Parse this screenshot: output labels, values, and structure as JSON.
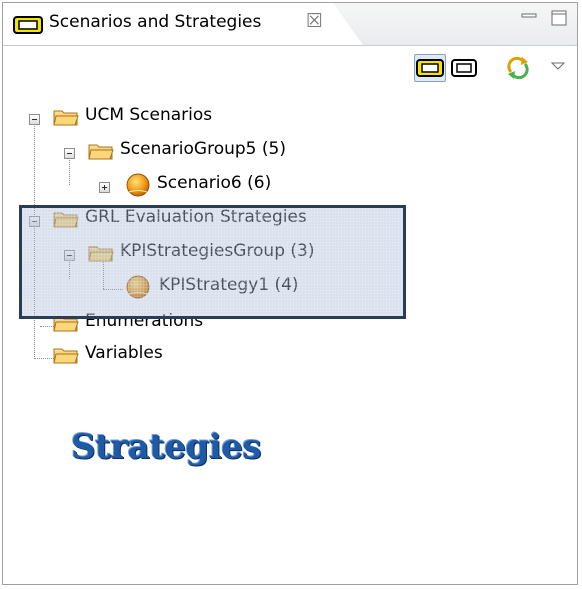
{
  "view": {
    "title": "Scenarios and Strategies",
    "close_glyph": "☒"
  },
  "toolbar": {
    "buttons": [
      {
        "name": "scenario-view-icon",
        "state": "active"
      },
      {
        "name": "strategy-view-icon",
        "state": "inactive"
      },
      {
        "name": "sync-icon"
      },
      {
        "name": "view-menu-icon"
      }
    ]
  },
  "tree": {
    "items": [
      {
        "label": "UCM Scenarios",
        "icon": "folder-icon",
        "expanded": true
      },
      {
        "label": "ScenarioGroup5 (5)",
        "icon": "folder-icon",
        "expanded": true
      },
      {
        "label": "Scenario6 (6)",
        "icon": "ucm-scenario-icon",
        "expanded": false
      },
      {
        "label": "GRL Evaluation Strategies",
        "icon": "folder-icon",
        "expanded": true
      },
      {
        "label": "KPIStrategiesGroup (3)",
        "icon": "folder-icon",
        "expanded": true
      },
      {
        "label": "KPIStrategy1 (4)",
        "icon": "grl-strategy-icon"
      },
      {
        "label": "Enumerations",
        "icon": "folder-icon"
      },
      {
        "label": "Variables",
        "icon": "folder-icon"
      }
    ]
  },
  "annotation": {
    "caption": "Strategies",
    "color": "#1f5aa6",
    "box_color": "#2b3c59"
  },
  "colors": {
    "folder": "#f2c14e",
    "ucm_icon": "#f59a1b",
    "grl_icon": "#e8a317",
    "active_button": "#dde9f6"
  }
}
